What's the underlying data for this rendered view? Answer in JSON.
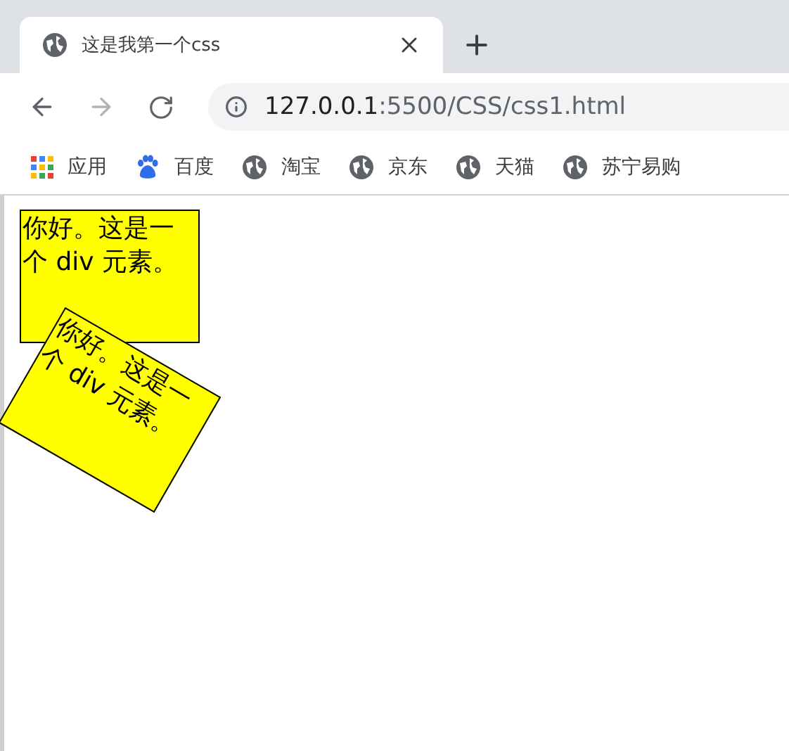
{
  "tab": {
    "title": "这是我第一个css",
    "selected": true
  },
  "nav": {
    "back_enabled": true,
    "forward_enabled": false
  },
  "address": {
    "host": "127.0.0.1",
    "path": ":5500/CSS/css1.html"
  },
  "bookmarks": [
    {
      "label": "应用",
      "kind": "apps"
    },
    {
      "label": "百度",
      "kind": "paw"
    },
    {
      "label": "淘宝",
      "kind": "globe"
    },
    {
      "label": "京东",
      "kind": "globe"
    },
    {
      "label": "天猫",
      "kind": "globe"
    },
    {
      "label": "苏宁易购",
      "kind": "globe"
    }
  ],
  "boxes": [
    {
      "text": "你好。这是一个 div 元素。",
      "rotated": false
    },
    {
      "text": "你好。这是一个 div 元素。",
      "rotated": true
    }
  ]
}
